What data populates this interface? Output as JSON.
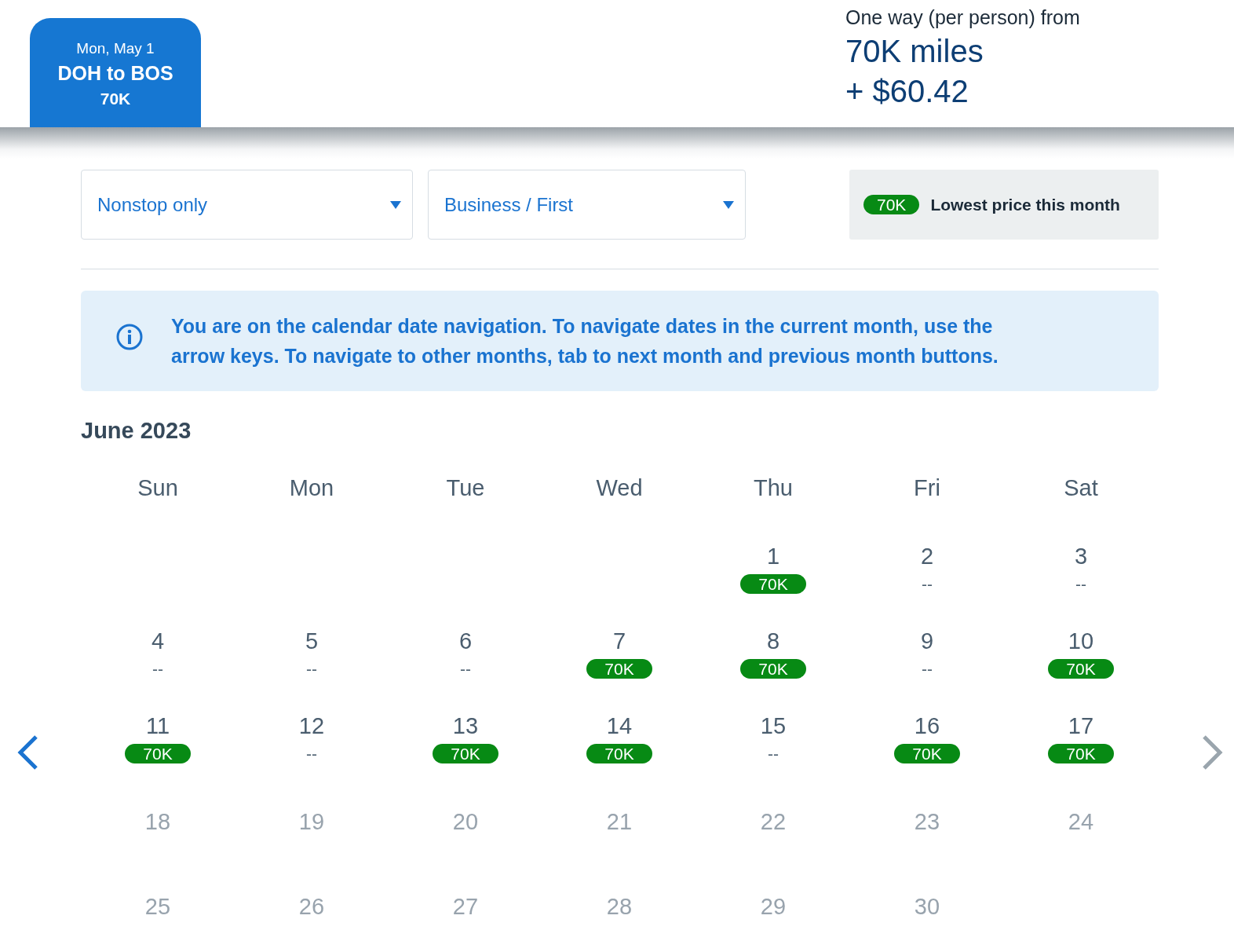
{
  "flight_tab": {
    "date": "Mon, May 1",
    "route": "DOH to BOS",
    "price": "70K",
    "selected": true
  },
  "fare": {
    "label": "One way (per person) from",
    "miles": "70K miles",
    "cash": "+ $60.42"
  },
  "filters": [
    {
      "value": "Nonstop only"
    },
    {
      "value": "Business / First"
    }
  ],
  "legend": {
    "badge": "70K",
    "label": "Lowest price this month"
  },
  "info": {
    "text": "You are on the calendar date navigation. To navigate dates in the current month, use the arrow keys. To navigate to other months, tab to next month and previous month buttons."
  },
  "calendar": {
    "month": "June 2023",
    "weekdays": [
      "Sun",
      "Mon",
      "Tue",
      "Wed",
      "Thu",
      "Fri",
      "Sat"
    ],
    "weeks": [
      [
        {
          "kind": "empty"
        },
        {
          "kind": "empty"
        },
        {
          "kind": "empty"
        },
        {
          "kind": "empty"
        },
        {
          "kind": "day",
          "day": "1",
          "price": "70K",
          "lowest": true,
          "disabled": false
        },
        {
          "kind": "day",
          "day": "2",
          "price": "--",
          "lowest": false,
          "disabled": false
        },
        {
          "kind": "day",
          "day": "3",
          "price": "--",
          "lowest": false,
          "disabled": false
        }
      ],
      [
        {
          "kind": "day",
          "day": "4",
          "price": "--",
          "lowest": false,
          "disabled": false
        },
        {
          "kind": "day",
          "day": "5",
          "price": "--",
          "lowest": false,
          "disabled": false
        },
        {
          "kind": "day",
          "day": "6",
          "price": "--",
          "lowest": false,
          "disabled": false
        },
        {
          "kind": "day",
          "day": "7",
          "price": "70K",
          "lowest": true,
          "disabled": false
        },
        {
          "kind": "day",
          "day": "8",
          "price": "70K",
          "lowest": true,
          "disabled": false
        },
        {
          "kind": "day",
          "day": "9",
          "price": "--",
          "lowest": false,
          "disabled": false
        },
        {
          "kind": "day",
          "day": "10",
          "price": "70K",
          "lowest": true,
          "disabled": false
        }
      ],
      [
        {
          "kind": "day",
          "day": "11",
          "price": "70K",
          "lowest": true,
          "disabled": false
        },
        {
          "kind": "day",
          "day": "12",
          "price": "--",
          "lowest": false,
          "disabled": false
        },
        {
          "kind": "day",
          "day": "13",
          "price": "70K",
          "lowest": true,
          "disabled": false
        },
        {
          "kind": "day",
          "day": "14",
          "price": "70K",
          "lowest": true,
          "disabled": false
        },
        {
          "kind": "day",
          "day": "15",
          "price": "--",
          "lowest": false,
          "disabled": false
        },
        {
          "kind": "day",
          "day": "16",
          "price": "70K",
          "lowest": true,
          "disabled": false
        },
        {
          "kind": "day",
          "day": "17",
          "price": "70K",
          "lowest": true,
          "disabled": false
        }
      ],
      [
        {
          "kind": "day",
          "day": "18",
          "disabled": true
        },
        {
          "kind": "day",
          "day": "19",
          "disabled": true
        },
        {
          "kind": "day",
          "day": "20",
          "disabled": true
        },
        {
          "kind": "day",
          "day": "21",
          "disabled": true
        },
        {
          "kind": "day",
          "day": "22",
          "disabled": true
        },
        {
          "kind": "day",
          "day": "23",
          "disabled": true
        },
        {
          "kind": "day",
          "day": "24",
          "disabled": true
        }
      ],
      [
        {
          "kind": "day",
          "day": "25",
          "disabled": true
        },
        {
          "kind": "day",
          "day": "26",
          "disabled": true
        },
        {
          "kind": "day",
          "day": "27",
          "disabled": true
        },
        {
          "kind": "day",
          "day": "28",
          "disabled": true
        },
        {
          "kind": "day",
          "day": "29",
          "disabled": true
        },
        {
          "kind": "day",
          "day": "30",
          "disabled": true
        },
        {
          "kind": "empty"
        }
      ]
    ]
  }
}
